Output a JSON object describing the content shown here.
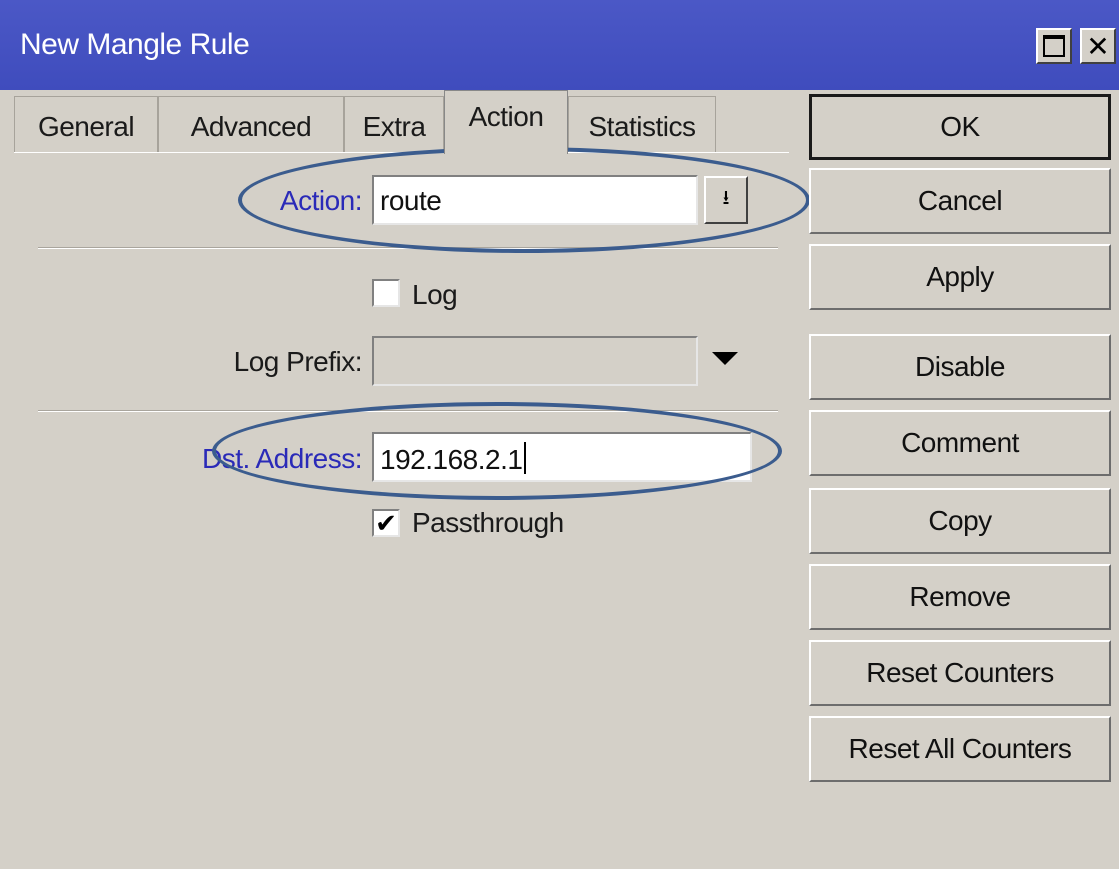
{
  "window": {
    "title": "New Mangle Rule"
  },
  "tabs": [
    {
      "label": "General"
    },
    {
      "label": "Advanced"
    },
    {
      "label": "Extra"
    },
    {
      "label": "Action",
      "active": true
    },
    {
      "label": "Statistics"
    }
  ],
  "form": {
    "action_label": "Action:",
    "action_value": "route",
    "log_label": "Log",
    "log_checked": false,
    "log_prefix_label": "Log Prefix:",
    "log_prefix_value": "",
    "dst_address_label": "Dst. Address:",
    "dst_address_value": "192.168.2.1",
    "passthrough_label": "Passthrough",
    "passthrough_checked": true
  },
  "buttons": {
    "ok": "OK",
    "cancel": "Cancel",
    "apply": "Apply",
    "disable": "Disable",
    "comment": "Comment",
    "copy": "Copy",
    "remove": "Remove",
    "reset_counters": "Reset Counters",
    "reset_all_counters": "Reset All Counters"
  },
  "colors": {
    "titlebar": "#4350c2",
    "label_accent": "#2a2ab8",
    "highlight_ellipse": "#3b5c8e",
    "window_bg": "#d4d0c8"
  }
}
